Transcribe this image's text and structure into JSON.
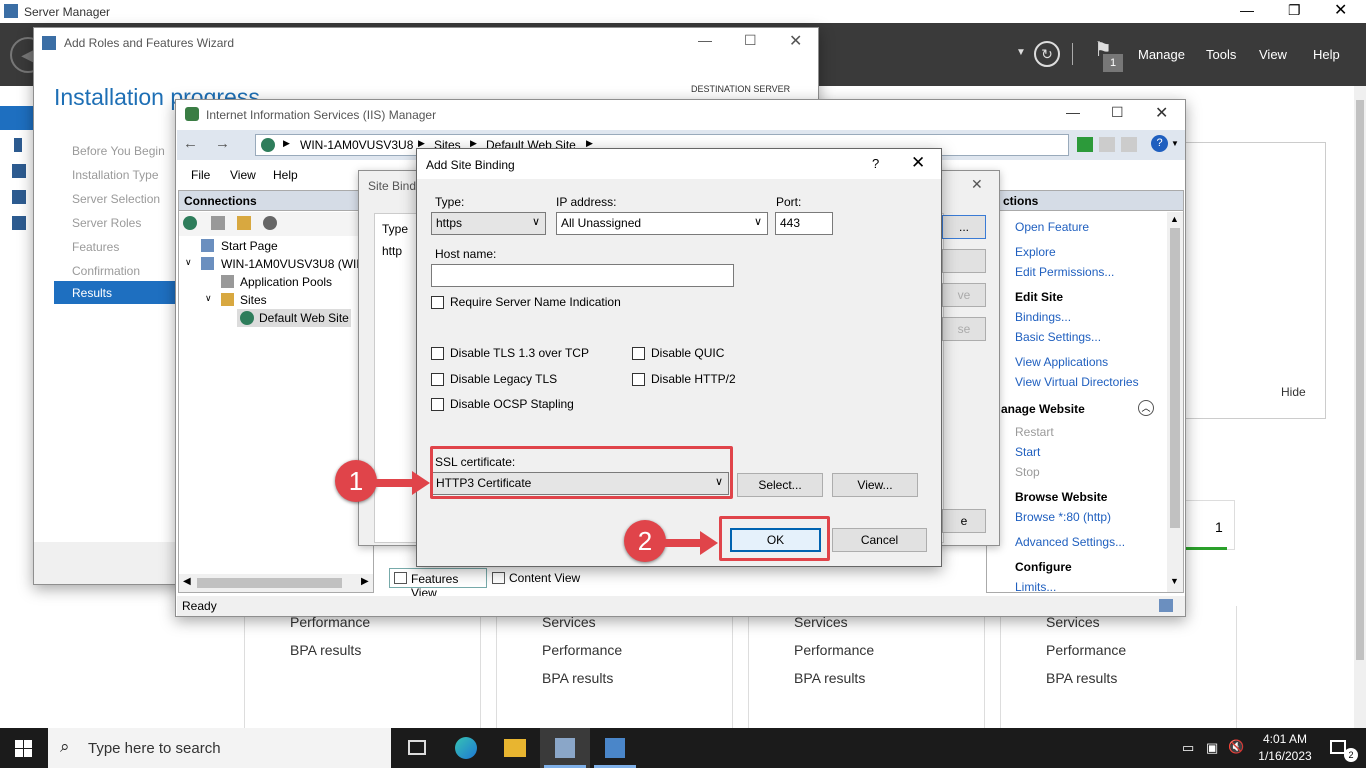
{
  "server_manager": {
    "title": "Server Manager",
    "menu": [
      "Manage",
      "Tools",
      "View",
      "Help"
    ],
    "notif_count": "1",
    "hide_label": "Hide",
    "tile_count": "1",
    "tiles": [
      {
        "items": [
          "Performance",
          "BPA results"
        ]
      },
      {
        "items": [
          "Services",
          "Performance",
          "BPA results"
        ]
      },
      {
        "items": [
          "Services",
          "Performance",
          "BPA results"
        ]
      },
      {
        "items": [
          "Services",
          "Performance",
          "BPA results"
        ]
      }
    ]
  },
  "wizard": {
    "title": "Add Roles and Features Wizard",
    "heading": "Installation progress",
    "dest_label": "DESTINATION SERVER",
    "steps": [
      "Before You Begin",
      "Installation Type",
      "Server Selection",
      "Server Roles",
      "Features",
      "Confirmation",
      "Results"
    ]
  },
  "iis": {
    "title": "Internet Information Services (IIS) Manager",
    "address": [
      "WIN-1AM0VUSV3U8",
      "Sites",
      "Default Web Site"
    ],
    "menu": [
      "File",
      "View",
      "Help"
    ],
    "connections_title": "Connections",
    "tree": [
      "Start Page",
      "WIN-1AM0VUSV3U8 (WIN",
      "Application Pools",
      "Sites",
      "Default Web Site"
    ],
    "status": "Ready",
    "features_view": "Features View",
    "content_view": "Content View",
    "actions_title": "ctions",
    "actions": {
      "open_feature": "Open Feature",
      "explore": "Explore",
      "edit_permissions": "Edit Permissions...",
      "edit_site": "Edit Site",
      "bindings": "Bindings...",
      "basic_settings": "Basic Settings...",
      "view_applications": "View Applications",
      "view_vdirs": "View Virtual Directories",
      "manage_website": "anage Website",
      "restart": "Restart",
      "start": "Start",
      "stop": "Stop",
      "browse_website": "Browse Website",
      "browse_80": "Browse *:80 (http)",
      "advanced_settings": "Advanced Settings...",
      "configure": "Configure",
      "limits": "Limits..."
    }
  },
  "site_bindings": {
    "title": "Site Bindi",
    "col_type": "Type",
    "row_type": "http",
    "btn_frags": [
      "...",
      "",
      "ve",
      "se",
      "e"
    ]
  },
  "add_binding": {
    "title": "Add Site Binding",
    "help": "?",
    "type_label": "Type:",
    "type_value": "https",
    "ip_label": "IP address:",
    "ip_value": "All Unassigned",
    "port_label": "Port:",
    "port_value": "443",
    "host_label": "Host name:",
    "host_value": "",
    "sni": "Require Server Name Indication",
    "checks_left": [
      "Disable TLS 1.3 over TCP",
      "Disable Legacy TLS",
      "Disable OCSP Stapling"
    ],
    "checks_right": [
      "Disable QUIC",
      "Disable HTTP/2"
    ],
    "ssl_label": "SSL certificate:",
    "ssl_value": "HTTP3 Certificate",
    "select_btn": "Select...",
    "view_btn": "View...",
    "ok_btn": "OK",
    "cancel_btn": "Cancel"
  },
  "annotations": {
    "step1": "1",
    "step2": "2"
  },
  "taskbar": {
    "search_placeholder": "Type here to search",
    "time": "4:01 AM",
    "date": "1/16/2023",
    "notif": "2"
  }
}
